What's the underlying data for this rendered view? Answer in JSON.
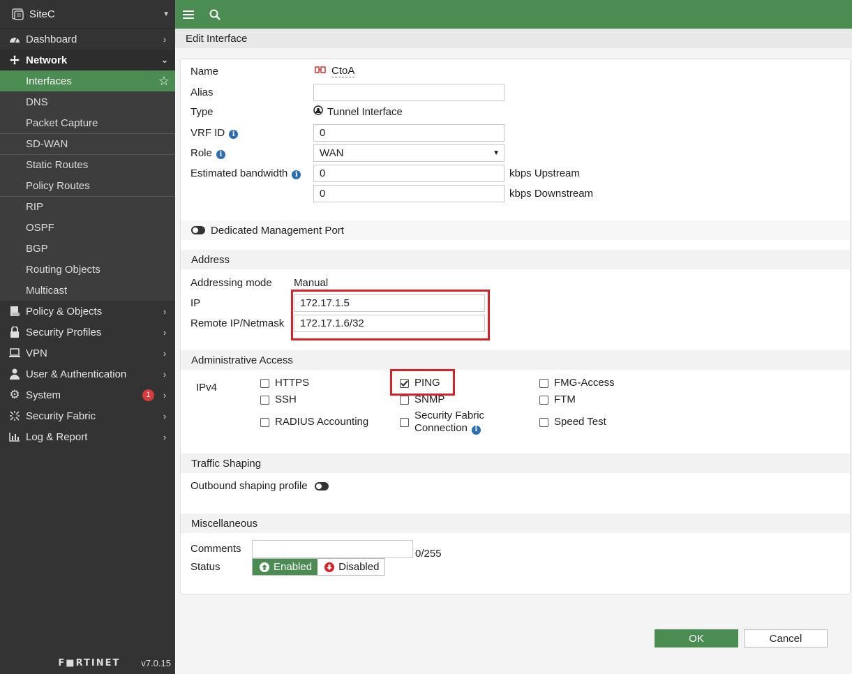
{
  "sidebar": {
    "device": "SiteC",
    "items": [
      {
        "label": "Dashboard",
        "icon": "dashboard-icon"
      },
      {
        "label": "Network",
        "icon": "network-icon"
      },
      {
        "label": "Policy & Objects",
        "icon": "policy-icon"
      },
      {
        "label": "Security Profiles",
        "icon": "lock-icon"
      },
      {
        "label": "VPN",
        "icon": "laptop-icon"
      },
      {
        "label": "User & Authentication",
        "icon": "user-icon"
      },
      {
        "label": "System",
        "icon": "gear-icon",
        "badge": "1"
      },
      {
        "label": "Security Fabric",
        "icon": "fabric-icon"
      },
      {
        "label": "Log & Report",
        "icon": "chart-icon"
      }
    ],
    "network_sub": [
      "Interfaces",
      "DNS",
      "Packet Capture",
      "SD-WAN",
      "Static Routes",
      "Policy Routes",
      "RIP",
      "OSPF",
      "BGP",
      "Routing Objects",
      "Multicast"
    ],
    "brand_logo": "F■RTINET",
    "version": "v7.0.15"
  },
  "header": {
    "title": "Edit Interface"
  },
  "form": {
    "name_label": "Name",
    "name_value": "CtoA",
    "alias_label": "Alias",
    "alias_value": "",
    "type_label": "Type",
    "type_value": "Tunnel Interface",
    "vrf_label": "VRF ID",
    "vrf_value": "0",
    "role_label": "Role",
    "role_value": "WAN",
    "bandwidth_label": "Estimated bandwidth",
    "upstream_value": "0",
    "upstream_unit": "kbps Upstream",
    "downstream_value": "0",
    "downstream_unit": "kbps Downstream",
    "dedicated_mgmt": "Dedicated Management Port"
  },
  "address": {
    "section": "Address",
    "mode_label": "Addressing mode",
    "mode_value": "Manual",
    "ip_label": "IP",
    "ip_value": "172.17.1.5",
    "remote_label": "Remote IP/Netmask",
    "remote_value": "172.17.1.6/32"
  },
  "admin": {
    "section": "Administrative Access",
    "ipv4": "IPv4",
    "https": "HTTPS",
    "ping": "PING",
    "fmg": "FMG-Access",
    "ssh": "SSH",
    "snmp": "SNMP",
    "ftm": "FTM",
    "radius": "RADIUS Accounting",
    "fabric_line1": "Security Fabric",
    "fabric_line2": "Connection",
    "speed": "Speed Test"
  },
  "traffic": {
    "section": "Traffic Shaping",
    "outbound": "Outbound shaping profile"
  },
  "misc": {
    "section": "Miscellaneous",
    "comments_label": "Comments",
    "comments_count": "0/255",
    "status_label": "Status",
    "enabled": "Enabled",
    "disabled": "Disabled"
  },
  "footer": {
    "ok": "OK",
    "cancel": "Cancel"
  },
  "colors": {
    "accent": "#4a8c52",
    "sidebar": "#333334",
    "highlight": "#d8222a"
  }
}
